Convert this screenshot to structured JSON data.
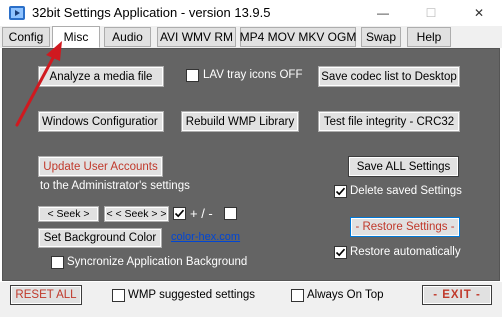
{
  "window": {
    "title": "32bit Settings Application - version 13.9.5",
    "minimize_glyph": "—",
    "maximize_glyph": "☐",
    "close_glyph": "✕"
  },
  "tabs": [
    {
      "label": "Config",
      "active": false
    },
    {
      "label": "Misc",
      "active": true
    },
    {
      "label": "Audio",
      "active": false
    },
    {
      "label": "AVI WMV RM",
      "active": false
    },
    {
      "label": "MP4 MOV MKV OGM",
      "active": false
    },
    {
      "label": "Swap",
      "active": false
    },
    {
      "label": "Help",
      "active": false
    }
  ],
  "misc": {
    "analyze_media_button": "Analyze a media file",
    "lav_tray_label": "LAV tray icons OFF",
    "lav_tray_checked": false,
    "save_codec_list_button": "Save codec list to Desktop",
    "windows_config_button": "Windows Configuratior",
    "rebuild_wmp_button": "Rebuild WMP Library",
    "test_integrity_button": "Test file integrity - CRC32",
    "update_accounts_button": "Update User Accounts",
    "admin_settings_label": "to the Administrator's settings",
    "save_all_button": "Save ALL Settings",
    "delete_saved_label": "Delete saved Settings",
    "delete_saved_checked": true,
    "seek_forward_button": "< Seek >",
    "seek_back_button": "< < Seek > >",
    "seek_plus_checked": true,
    "plus_minus_label": "+ / -",
    "seek_minus_checked": false,
    "set_background_button": "Set Background Color",
    "color_hex_link": "color-hex.com",
    "restore_settings_button": "- Restore Settings -",
    "restore_auto_label": "Restore automatically",
    "restore_auto_checked": true,
    "sync_background_label": "Syncronize Application Background",
    "sync_background_checked": false
  },
  "bottom": {
    "reset_all_button": "RESET ALL",
    "wmp_suggested_label": "WMP suggested settings",
    "wmp_suggested_checked": false,
    "always_on_top_label": "Always On Top",
    "always_on_top_checked": false,
    "exit_button": "- EXIT -"
  },
  "colors": {
    "panel_bg": "#646464",
    "annotation_arrow": "#d0191f",
    "link": "#0046d5",
    "red_text": "#c0392b"
  }
}
